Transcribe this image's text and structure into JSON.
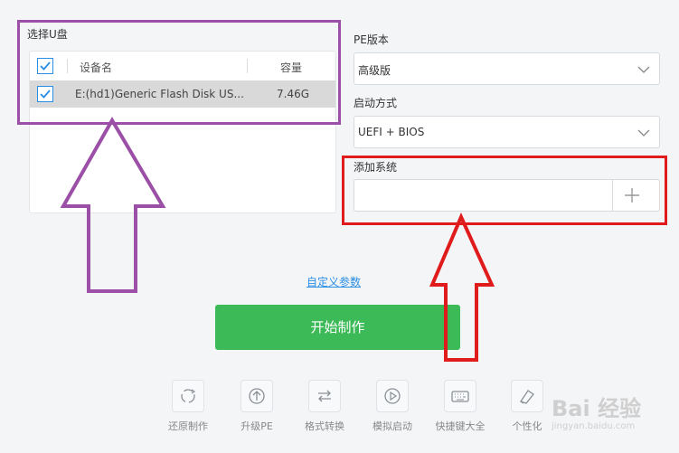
{
  "usb": {
    "title": "选择U盘",
    "col_device": "设备名",
    "col_capacity": "容量",
    "rows": [
      {
        "name": "E:(hd1)Generic Flash Disk US...",
        "capacity": "7.46G",
        "checked": true
      }
    ]
  },
  "pe": {
    "label": "PE版本",
    "value": "高级版"
  },
  "boot": {
    "label": "启动方式",
    "value": "UEFI + BIOS"
  },
  "add_system": {
    "label": "添加系统",
    "value": ""
  },
  "custom_params": "自定义参数",
  "start_button": "开始制作",
  "tools": [
    {
      "label": "还原制作",
      "icon": "restore-icon"
    },
    {
      "label": "升级PE",
      "icon": "upgrade-icon"
    },
    {
      "label": "格式转换",
      "icon": "convert-icon"
    },
    {
      "label": "模拟启动",
      "icon": "play-icon"
    },
    {
      "label": "快捷键大全",
      "icon": "keyboard-icon"
    },
    {
      "label": "个性化",
      "icon": "personalize-icon"
    }
  ],
  "watermark": {
    "brand": "Bai 经验",
    "url": "jingyan.baidu.com"
  },
  "colors": {
    "accent": "#2b8ee6",
    "start_button": "#3dba58",
    "annotation_purple": "#9b4fa6",
    "annotation_red": "#e01b1b"
  }
}
